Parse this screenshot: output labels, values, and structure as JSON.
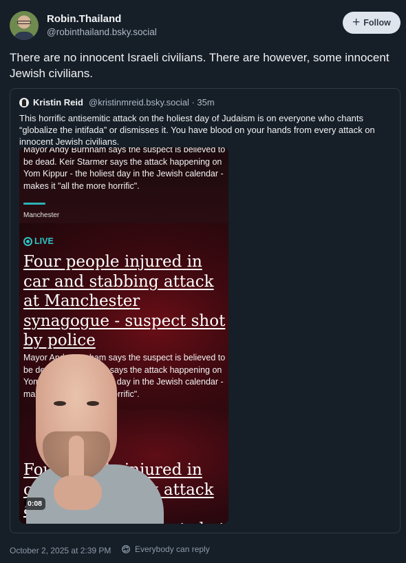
{
  "author": {
    "display_name": "Robin.Thailand",
    "handle": "@robinthailand.bsky.social"
  },
  "follow_button": {
    "label": "Follow",
    "icon": "plus-icon"
  },
  "post": {
    "text": "There are no innocent Israeli civilians. There are however, some innocent Jewish civilians.",
    "timestamp": "October 2, 2025 at 2:39 PM",
    "reply_setting": "Everybody can reply",
    "reply_icon": "globe-refresh-icon"
  },
  "quote": {
    "author_name": "Kristin Reid",
    "handle_time": "@kristinmreid.bsky.social · 35m",
    "text": "This horrific antisemitic attack on the holiest day of Judaism is on everyone who chants “globalize the intifada” or dismisses it. You have blood on your hands from every attack on innocent Jewish civilians.",
    "video": {
      "duration": "0:08",
      "summary": "Mayor Andy Burnham says the suspect is believed to be dead. Keir Starmer says the attack happening on Yom Kippur - the holiest day in the Jewish calendar - makes it \"all the more horrific\".",
      "location": "Manchester",
      "live_label": "LIVE",
      "headline": "Four people injured in car and stabbing attack at Manchester synagogue - suspect shot by police"
    }
  },
  "colors": {
    "background": "#161e27",
    "follow_button_bg": "#dfe5ec",
    "live_accent": "#2ec4c6",
    "muted_text": "#aebbc9"
  }
}
